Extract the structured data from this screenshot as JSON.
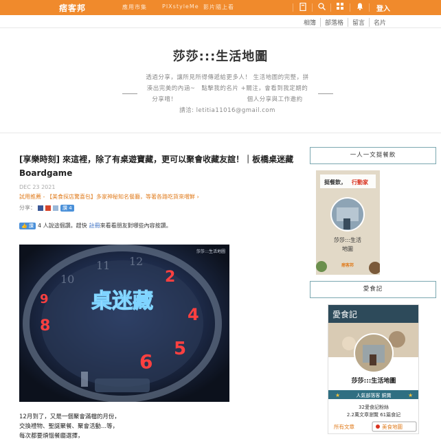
{
  "topbar": {
    "logo": "痞客邦",
    "nav": [
      "應用市集",
      "PIXstyleMe",
      "影片隨上看"
    ],
    "icons": [
      "bookmark-icon",
      "search-icon",
      "grid-icon",
      "bell-icon"
    ],
    "login": "登入"
  },
  "sublinks": [
    "相簿",
    "部落格",
    "留言",
    "名片"
  ],
  "header": {
    "title": "莎莎:::生活地圖",
    "intro_lines": [
      "透過分享，讓所見所得傳遞給更多人！ 生活地圖的完整，拼",
      "湊出完美的內涵~　點擊我的名片 +關注，會看到我定期的",
      "分享唷！　　　　　　　　　　　 個人分享與工作邀約",
      "請洽: letitia11016@gmail.com"
    ]
  },
  "post": {
    "title": "[享樂時刻] 來這裡，除了有桌遊寶藏，更可以聚會收藏友誼！｜板橋桌迷藏 Boardgame",
    "date": "DEC 23 2021",
    "recommend": "試用推薦 - 【美食探店驚喜包】多家神秘知名餐廳，等著各路吃貨來嚐鮮 ›",
    "share_label": "分享：",
    "like_button": "讚 4",
    "like_count_text": "4 人說這個讚。趕快",
    "like_link": "註冊",
    "like_tail": "來看看朋友對哪些內容按讚。",
    "photo_sign": "桌迷藏",
    "photo_watermark": "莎莎:::生活地圖",
    "body_lines": [
      "12月到了，又是一個聚會滿檔的月份，",
      "交換禮物、聖誕聚餐、聚會活動...等，",
      "每次都要煩惱餐廳選擇，"
    ]
  },
  "sidebar": {
    "box1": "一人一文挺餐飲",
    "banner1": {
      "headline": "挺餐飲，",
      "headline_accent": "行動家",
      "blogger": "莎莎:::生活",
      "blogger2": "地圖",
      "brand": "痞客邦"
    },
    "box2": "愛食記",
    "banner2": {
      "brand": "愛食記",
      "blogger": "莎莎:::生活地圖",
      "badge": "人氣部落客 銅賞",
      "fans": "32愛食記粉絲",
      "stats": "2.2萬文章瀏覽 61篇食記",
      "tab_articles": "所有文章",
      "tab_map": "美食地圖"
    }
  },
  "colors": {
    "topbar": "#f08a2c",
    "accent_orange": "#e07c1e",
    "sidebar_border": "#7aa7b0",
    "banner2_head": "#2d4a5a",
    "badge_bg": "#2f6f82"
  }
}
